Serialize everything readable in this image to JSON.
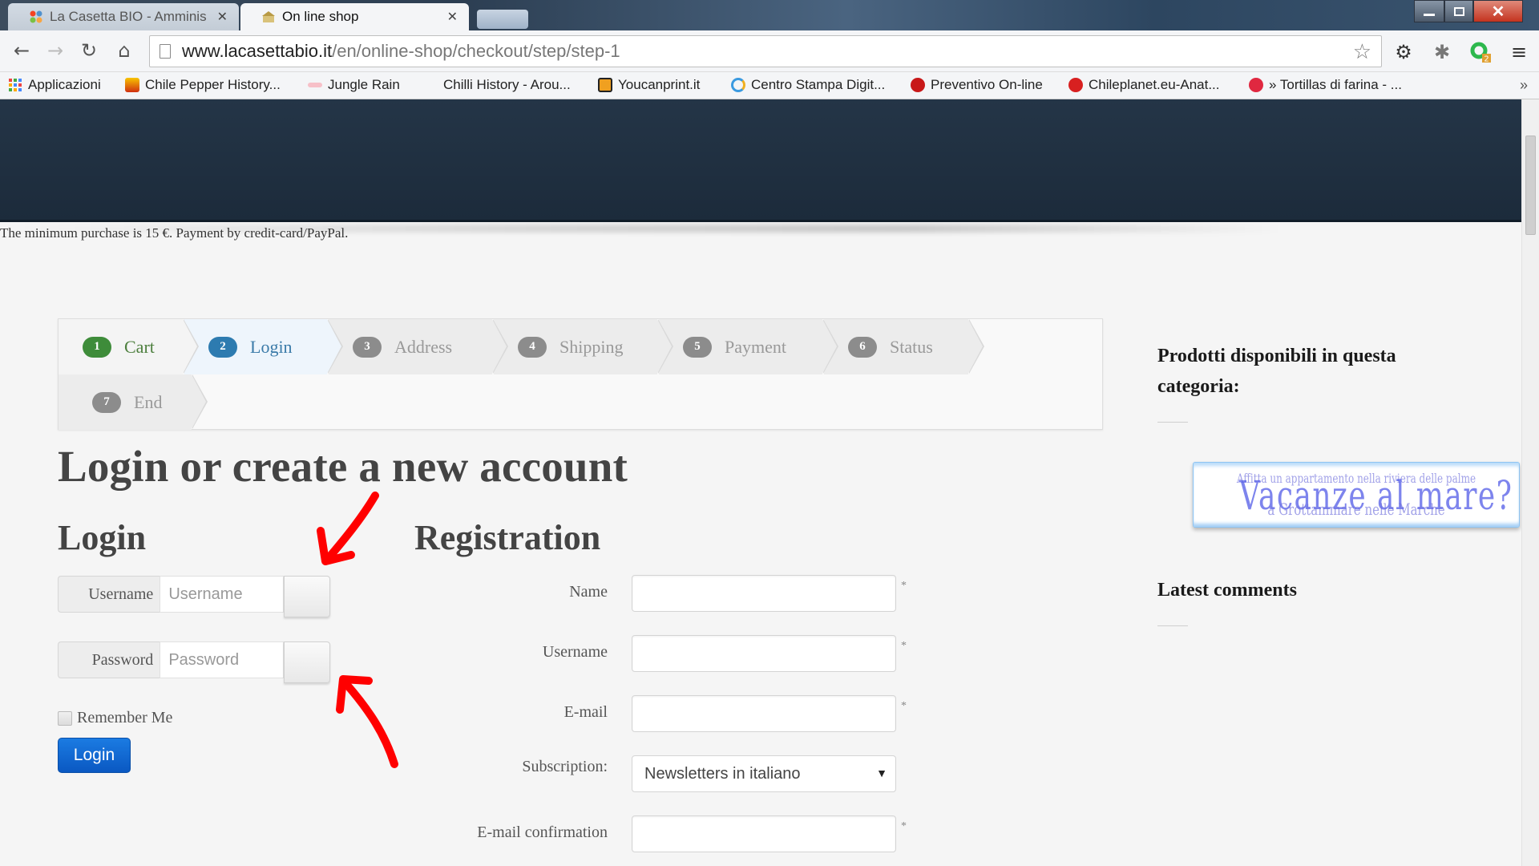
{
  "browser": {
    "tabs": [
      {
        "title": "La Casetta BIO - Amminis",
        "active": false,
        "icon": "joomla-icon"
      },
      {
        "title": "On line shop",
        "active": true,
        "icon": "shop-icon"
      }
    ],
    "url_host": "www.lacasettabio.it",
    "url_path": "/en/online-shop/checkout/step/step-1",
    "bookmarks": [
      {
        "label": "Applicazioni",
        "icon": "apps-grid-icon"
      },
      {
        "label": "Chile Pepper History...",
        "icon": "chile-pepper-icon"
      },
      {
        "label": "Jungle Rain",
        "icon": "jungle-rain-icon"
      },
      {
        "label": "Chilli History - Arou...",
        "icon": ""
      },
      {
        "label": "Youcanprint.it",
        "icon": "youcanprint-icon"
      },
      {
        "label": "Centro Stampa Digit...",
        "icon": "centro-stampa-icon"
      },
      {
        "label": "Preventivo On-line",
        "icon": "red-dot-icon"
      },
      {
        "label": "Chileplanet.eu-Anat...",
        "icon": "chileplanet-icon"
      },
      {
        "label": "» Tortillas di farina - ...",
        "icon": "strawberry-icon"
      }
    ],
    "bookmarks_overflow": "»",
    "extension_badge": "2",
    "colors": {
      "close_button": "#c4331f"
    }
  },
  "page": {
    "notice": "The minimum purchase is 15 €. Payment by credit-card/PayPal.",
    "steps": [
      {
        "num": "1",
        "label": "Cart",
        "state": "done"
      },
      {
        "num": "2",
        "label": "Login",
        "state": "current"
      },
      {
        "num": "3",
        "label": "Address",
        "state": "pending"
      },
      {
        "num": "4",
        "label": "Shipping",
        "state": "pending"
      },
      {
        "num": "5",
        "label": "Payment",
        "state": "pending"
      },
      {
        "num": "6",
        "label": "Status",
        "state": "pending"
      },
      {
        "num": "7",
        "label": "End",
        "state": "pending"
      }
    ],
    "title": "Login or create a new account",
    "login": {
      "heading": "Login",
      "username_label": "Username",
      "username_placeholder": "Username",
      "username_value": "",
      "password_label": "Password",
      "password_placeholder": "Password",
      "password_value": "",
      "remember_label": "Remember Me",
      "remember_checked": false,
      "button": "Login"
    },
    "registration": {
      "heading": "Registration",
      "fields": [
        {
          "label": "Name",
          "value": "",
          "required": "*",
          "type": "text"
        },
        {
          "label": "Username",
          "value": "",
          "required": "*",
          "type": "text"
        },
        {
          "label": "E-mail",
          "value": "",
          "required": "*",
          "type": "text"
        },
        {
          "label": "Subscription:",
          "value": "Newsletters in italiano",
          "required": "",
          "type": "select"
        },
        {
          "label": "E-mail confirmation",
          "value": "",
          "required": "*",
          "type": "text"
        }
      ]
    },
    "sidebar": {
      "products_heading": "Prodotti disponibili in questa categoria:",
      "ad": {
        "line_top": "Affitta un appartamento nella riviera delle palme",
        "line_main": "Vacanze al mare?",
        "line_bottom": "a Grottammare nelle Marche"
      },
      "comments_heading": "Latest comments"
    },
    "colors": {
      "header_bg": "#1e2d3e",
      "page_bg": "#f5f5f5",
      "step_done": "#3e8c3a",
      "step_current": "#2d7bb0",
      "step_pending": "#8c8c8c",
      "login_button": "#0a68d6",
      "annotation_arrow": "#ff0000"
    }
  }
}
